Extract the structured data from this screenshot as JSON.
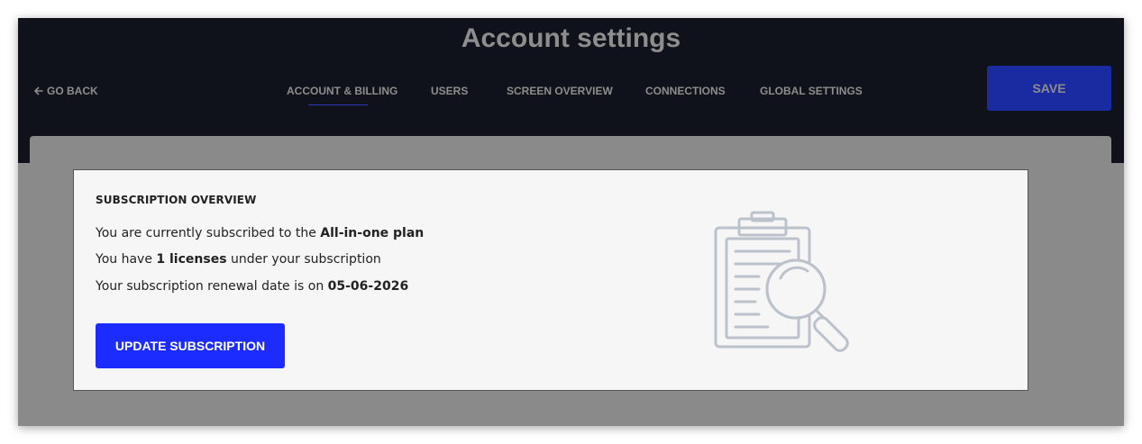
{
  "header": {
    "title": "Account settings",
    "back_label": "GO BACK",
    "save_label": "SAVE"
  },
  "tabs": [
    {
      "label": "ACCOUNT & BILLING",
      "active": true
    },
    {
      "label": "USERS",
      "active": false
    },
    {
      "label": "SCREEN OVERVIEW",
      "active": false
    },
    {
      "label": "CONNECTIONS",
      "active": false
    },
    {
      "label": "GLOBAL SETTINGS",
      "active": false
    }
  ],
  "subscription": {
    "heading": "SUBSCRIPTION OVERVIEW",
    "plan_prefix": "You are currently subscribed to the ",
    "plan_name": "All-in-one plan",
    "licenses_prefix": "You have ",
    "licenses_count": "1 licenses",
    "licenses_suffix": " under your subscription",
    "renewal_prefix": "Your subscription renewal date is on ",
    "renewal_date": "05-06-2026",
    "update_label": "UPDATE SUBSCRIPTION"
  },
  "icons": {
    "back": "arrow-left-icon",
    "illustration": "clipboard-magnifier-icon"
  },
  "colors": {
    "header_bg": "#0f121a",
    "overlay": "#8a8a8a",
    "save_button": "#1a2aa0",
    "primary_button": "#1c2cff",
    "active_tab_underline": "#2a37b8"
  }
}
